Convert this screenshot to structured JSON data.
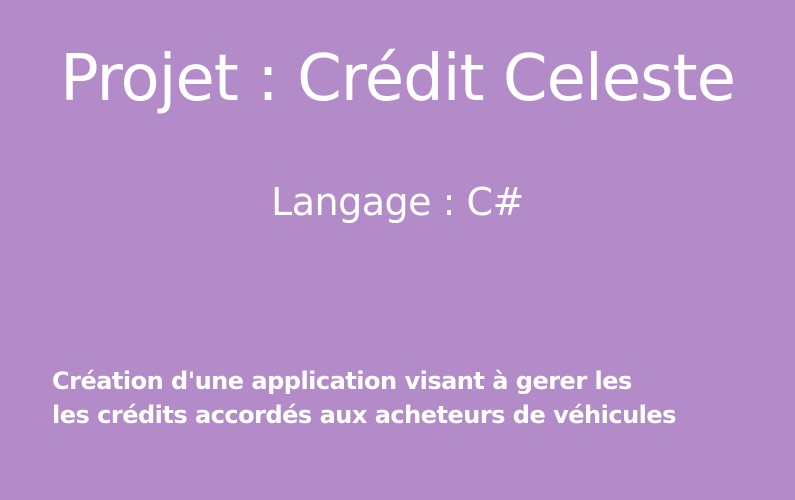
{
  "title": "Projet : Crédit Celeste",
  "subtitle": "Langage : C#",
  "description": {
    "line1": "Création d'une application visant à gerer les",
    "line2": "les crédits accordés aux acheteurs de véhicules"
  },
  "colors": {
    "background": "#b48bc9",
    "text": "#ffffff"
  }
}
